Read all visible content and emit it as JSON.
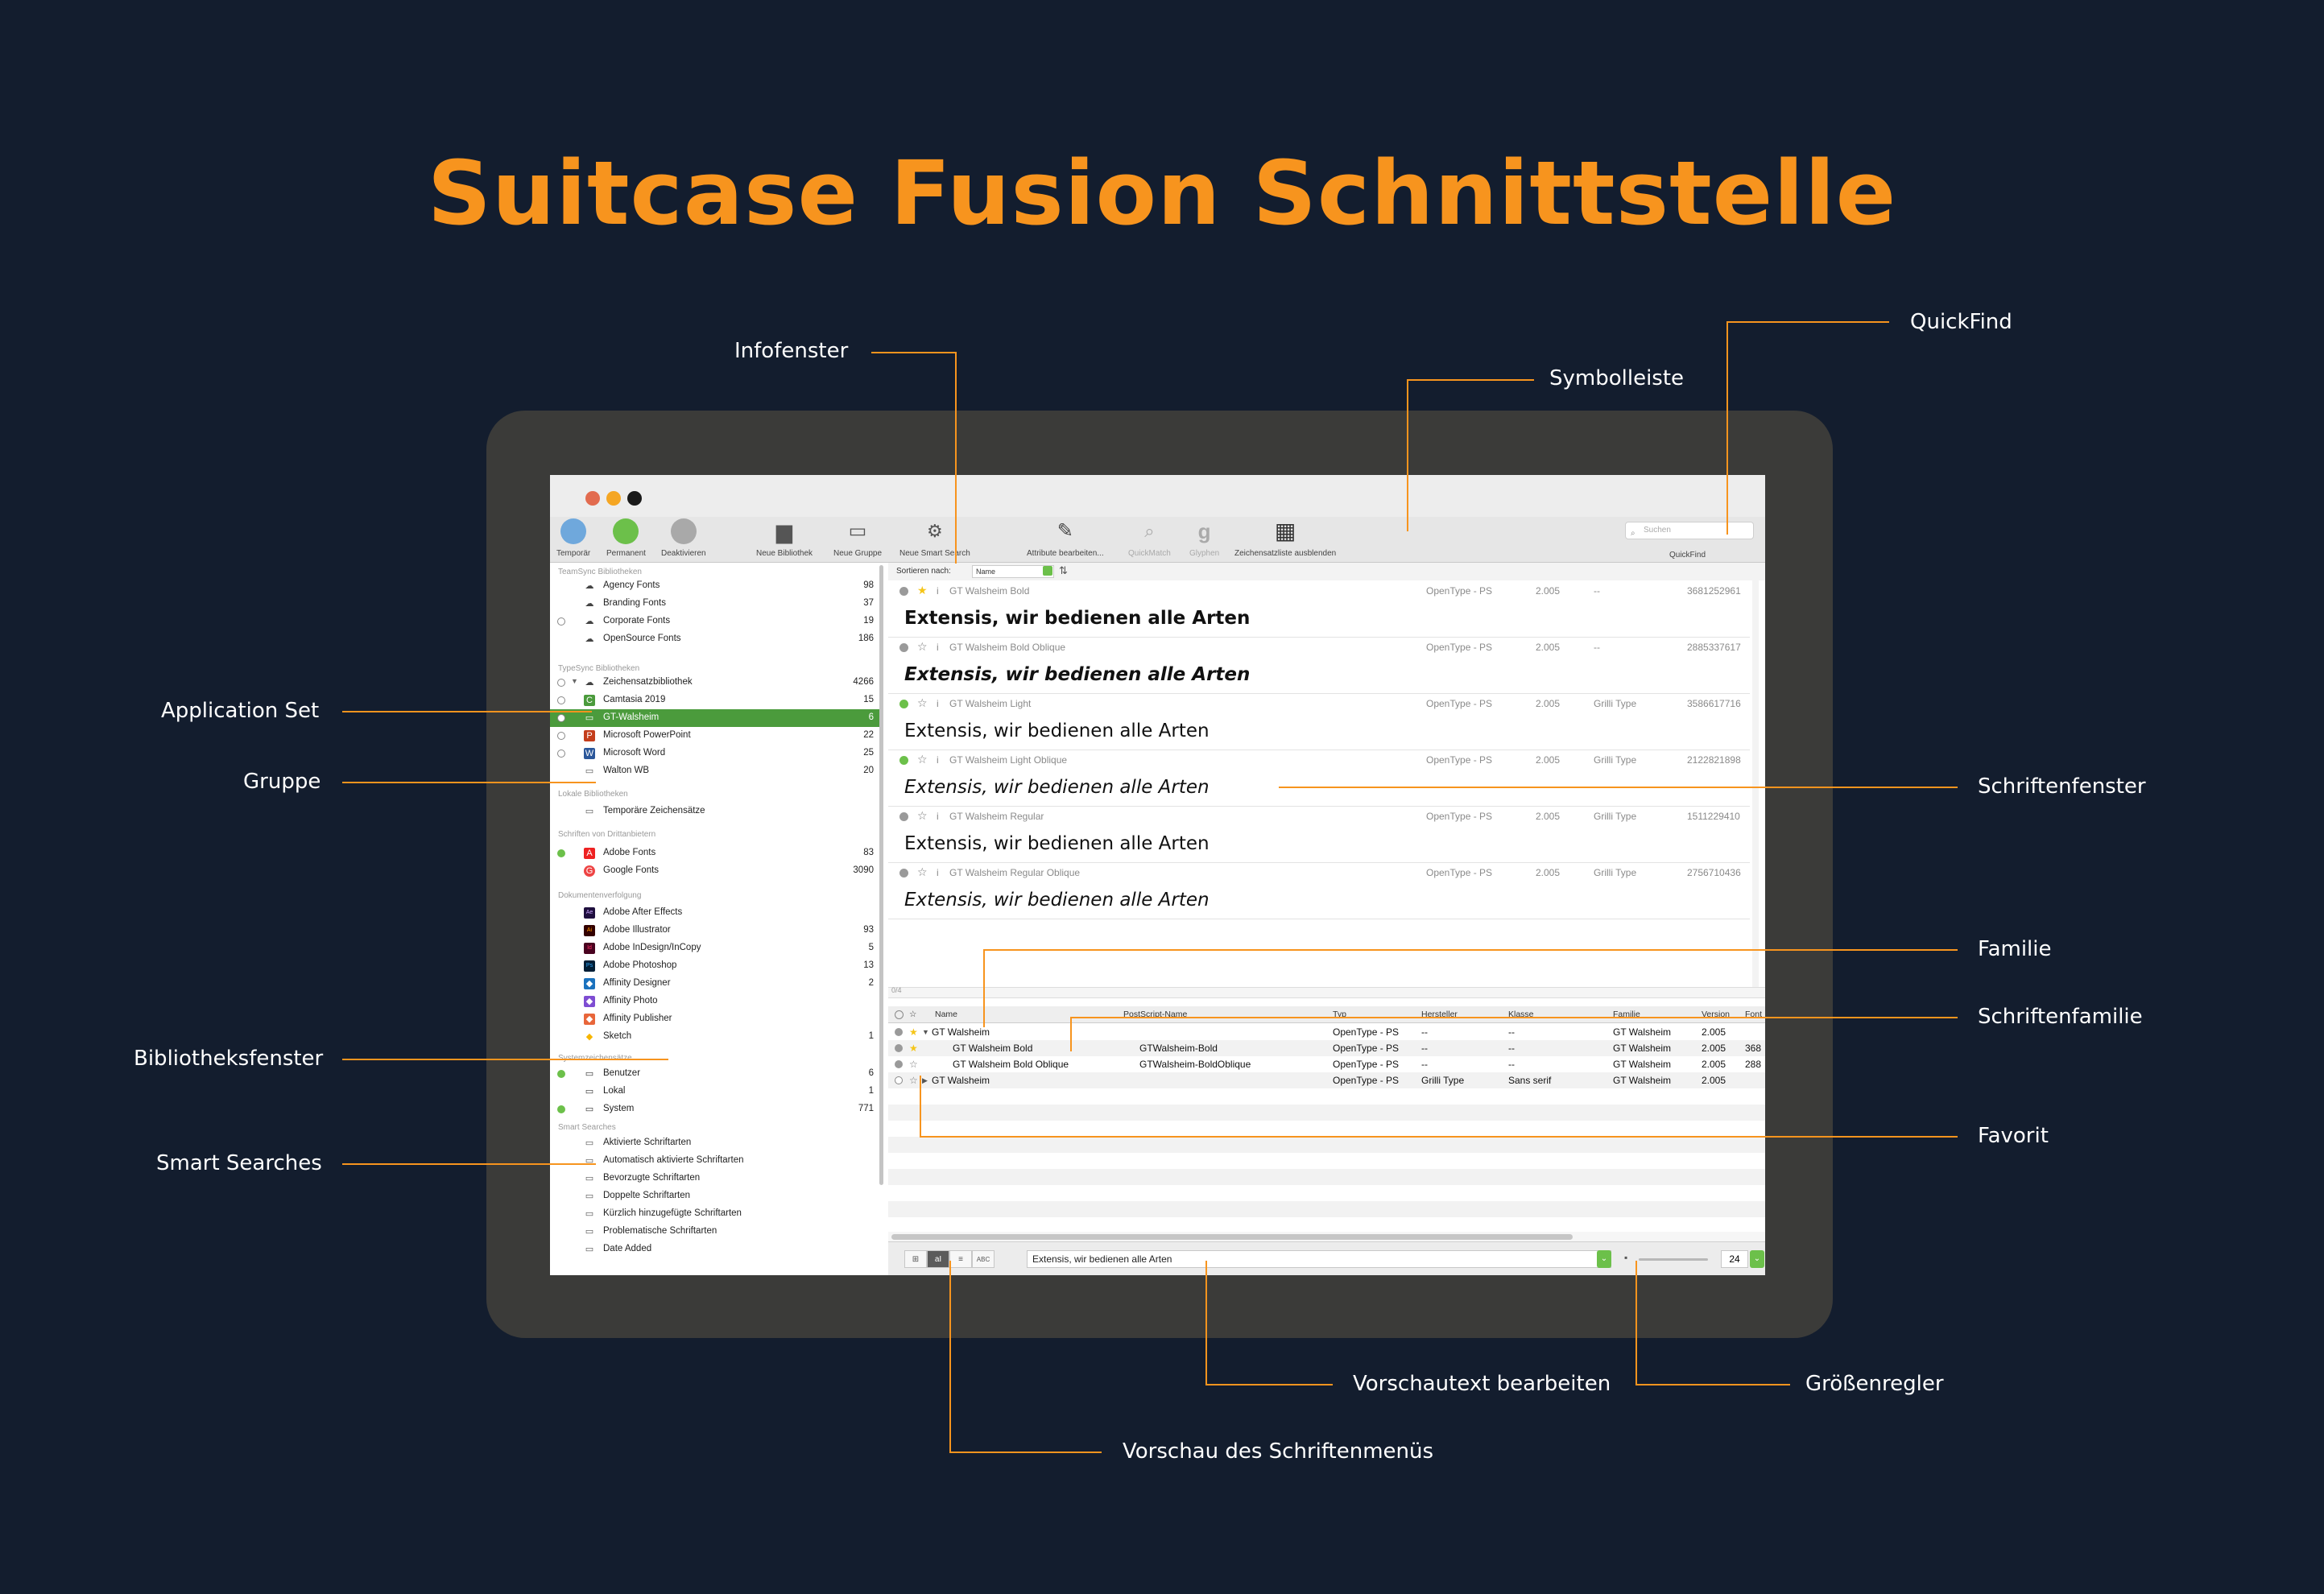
{
  "title": "Suitcase Fusion Schnittstelle",
  "accent_color": "#f7941e",
  "window": {
    "traffic_lights": [
      "#e26b4f",
      "#f5a623",
      "#1a1a1a"
    ],
    "toolbar": {
      "temporaer": "Temporär",
      "permanent": "Permanent",
      "deaktivieren": "Deaktivieren",
      "neue_bibliothek": "Neue Bibliothek",
      "neue_gruppe": "Neue Gruppe",
      "neue_smart_search": "Neue Smart Search",
      "attribute": "Attribute bearbeiten...",
      "quickmatch": "QuickMatch",
      "glyphen": "Glyphen",
      "zeichensatzliste": "Zeichensatzliste ausblenden",
      "search_placeholder": "Suchen",
      "quickfind": "QuickFind"
    },
    "sidebar": {
      "sections": {
        "teamsync": "TeamSync Bibliotheken",
        "typesync": "TypeSync Bibliotheken",
        "lokal": "Lokale Bibliotheken",
        "dritt": "Schriften von Drittanbietern",
        "doku": "Dokumentenverfolgung",
        "system": "Systemzeichensätze",
        "smart": "Smart Searches"
      },
      "items": [
        {
          "label": "Agency Fonts",
          "count": "98"
        },
        {
          "label": "Branding Fonts",
          "count": "37"
        },
        {
          "label": "Corporate Fonts",
          "count": "19"
        },
        {
          "label": "OpenSource Fonts",
          "count": "186"
        },
        {
          "label": "Zeichensatzbibliothek",
          "count": "4266"
        },
        {
          "label": "Camtasia 2019",
          "count": "15"
        },
        {
          "label": "GT-Walsheim",
          "count": "6"
        },
        {
          "label": "Microsoft PowerPoint",
          "count": "22"
        },
        {
          "label": "Microsoft Word",
          "count": "25"
        },
        {
          "label": "Walton WB",
          "count": "20"
        },
        {
          "label": "Temporäre Zeichensätze",
          "count": ""
        },
        {
          "label": "Adobe Fonts",
          "count": "83"
        },
        {
          "label": "Google Fonts",
          "count": "3090"
        },
        {
          "label": "Adobe After Effects",
          "count": ""
        },
        {
          "label": "Adobe Illustrator",
          "count": "93"
        },
        {
          "label": "Adobe InDesign/InCopy",
          "count": "5"
        },
        {
          "label": "Adobe Photoshop",
          "count": "13"
        },
        {
          "label": "Affinity Designer",
          "count": "2"
        },
        {
          "label": "Affinity Photo",
          "count": ""
        },
        {
          "label": "Affinity Publisher",
          "count": ""
        },
        {
          "label": "Sketch",
          "count": "1"
        },
        {
          "label": "Benutzer",
          "count": "6"
        },
        {
          "label": "Lokal",
          "count": "1"
        },
        {
          "label": "System",
          "count": "771"
        },
        {
          "label": "Aktivierte Schriftarten",
          "count": ""
        },
        {
          "label": "Automatisch aktivierte Schriftarten",
          "count": ""
        },
        {
          "label": "Bevorzugte Schriftarten",
          "count": ""
        },
        {
          "label": "Doppelte Schriftarten",
          "count": ""
        },
        {
          "label": "Kürzlich hinzugefügte Schriftarten",
          "count": ""
        },
        {
          "label": "Problematische Schriftarten",
          "count": ""
        },
        {
          "label": "Date Added",
          "count": ""
        }
      ]
    },
    "sort": {
      "label": "Sortieren nach:",
      "value": "Name"
    },
    "font_entries": [
      {
        "name": "GT Walsheim Bold",
        "type": "OpenType - PS",
        "version": "2.005",
        "maker": "--",
        "id": "3681252961",
        "preview": "Extensis, wir bedienen alle Arten"
      },
      {
        "name": "GT Walsheim Bold Oblique",
        "type": "OpenType - PS",
        "version": "2.005",
        "maker": "--",
        "id": "2885337617",
        "preview": "Extensis, wir bedienen alle Arten"
      },
      {
        "name": "GT Walsheim Light",
        "type": "OpenType - PS",
        "version": "2.005",
        "maker": "Grilli Type",
        "id": "3586617716",
        "preview": "Extensis, wir bedienen alle Arten"
      },
      {
        "name": "GT Walsheim Light Oblique",
        "type": "OpenType - PS",
        "version": "2.005",
        "maker": "Grilli Type",
        "id": "2122821898",
        "preview": "Extensis, wir bedienen alle Arten"
      },
      {
        "name": "GT Walsheim Regular",
        "type": "OpenType - PS",
        "version": "2.005",
        "maker": "Grilli Type",
        "id": "1511229410",
        "preview": "Extensis, wir bedienen alle Arten"
      },
      {
        "name": "GT Walsheim Regular Oblique",
        "type": "OpenType - PS",
        "version": "2.005",
        "maker": "Grilli Type",
        "id": "2756710436",
        "preview": "Extensis, wir bedienen alle Arten"
      }
    ],
    "pane_counter": "0/4",
    "list": {
      "headers": {
        "name": "Name",
        "postscript": "PostScript-Name",
        "typ": "Typ",
        "hersteller": "Hersteller",
        "klasse": "Klasse",
        "familie": "Familie",
        "version": "Version",
        "font": "Font"
      },
      "rows": [
        {
          "name": "GT Walsheim",
          "ps": "",
          "typ": "OpenType - PS",
          "hersteller": "--",
          "klasse": "--",
          "familie": "GT Walsheim",
          "version": "2.005",
          "extra": ""
        },
        {
          "name": "GT Walsheim Bold",
          "ps": "GTWalsheim-Bold",
          "typ": "OpenType - PS",
          "hersteller": "--",
          "klasse": "--",
          "familie": "GT Walsheim",
          "version": "2.005",
          "extra": "368"
        },
        {
          "name": "GT Walsheim Bold Oblique",
          "ps": "GTWalsheim-BoldOblique",
          "typ": "OpenType - PS",
          "hersteller": "--",
          "klasse": "--",
          "familie": "GT Walsheim",
          "version": "2.005",
          "extra": "288"
        },
        {
          "name": "GT Walsheim",
          "ps": "",
          "typ": "OpenType - PS",
          "hersteller": "Grilli Type",
          "klasse": "Sans serif",
          "familie": "GT Walsheim",
          "version": "2.005",
          "extra": ""
        }
      ]
    },
    "bottom": {
      "preview_text": "Extensis, wir bedienen alle Arten",
      "size": "24",
      "seg_labels": [
        "⊞",
        "aI",
        "≡",
        "ABC"
      ]
    }
  },
  "callouts": {
    "infofenster": "Infofenster",
    "symbolleiste": "Symbolleiste",
    "quickfind": "QuickFind",
    "application_set": "Application Set",
    "gruppe": "Gruppe",
    "bibliotheksfenster": "Bibliotheksfenster",
    "smart_searches": "Smart Searches",
    "schriftenfenster": "Schriftenfenster",
    "familie": "Familie",
    "schriftenfamilie": "Schriftenfamilie",
    "favorit": "Favorit",
    "vorschautext": "Vorschautext bearbeiten",
    "groessenregler": "Größenregler",
    "vorschau_menue": "Vorschau des Schriftenmenüs"
  }
}
